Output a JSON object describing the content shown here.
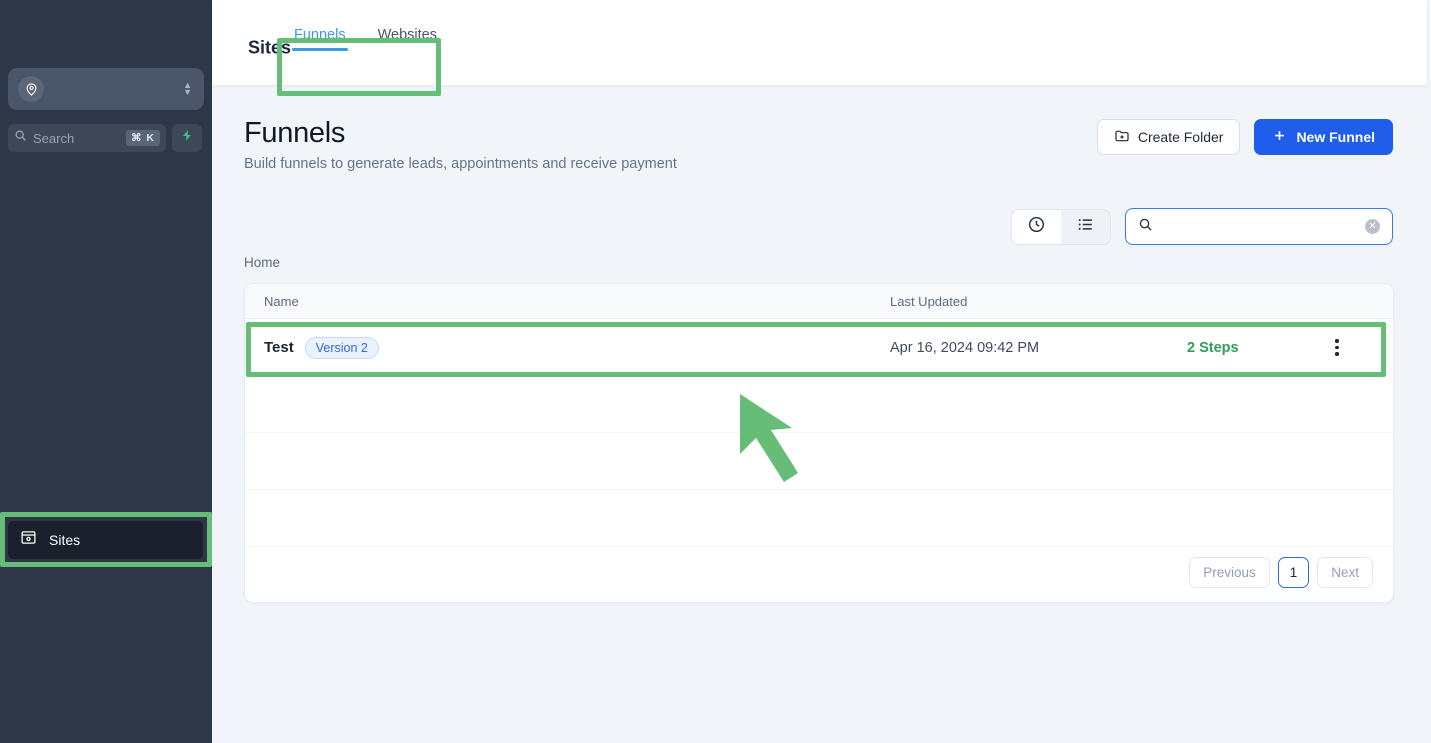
{
  "sidebar": {
    "location_switcher": {
      "icon": "location-pin-icon",
      "value": ""
    },
    "search": {
      "placeholder": "Search",
      "shortcut": "⌘ K",
      "icon": "search-icon"
    },
    "quick_action": {
      "icon": "lightning-bolt-icon"
    },
    "items": [
      {
        "label": "Sites",
        "icon": "sites-icon",
        "active": true
      }
    ]
  },
  "topbar": {
    "title": "Sites",
    "tabs": [
      {
        "label": "Funnels",
        "active": true
      },
      {
        "label": "Websites",
        "active": false
      }
    ]
  },
  "page": {
    "title": "Funnels",
    "subtitle": "Build funnels to generate leads, appointments and receive payment",
    "create_folder_label": "Create Folder",
    "new_funnel_label": "New Funnel",
    "breadcrumb": "Home"
  },
  "toolbar": {
    "view_recent_icon": "clock-icon",
    "view_list_icon": "list-icon",
    "search": {
      "value": "",
      "placeholder": "",
      "icon": "search-icon",
      "clear_icon": "clear-circle-icon"
    }
  },
  "table": {
    "columns": [
      "Name",
      "Last Updated",
      "",
      ""
    ],
    "rows": [
      {
        "name": "Test",
        "badge": "Version 2",
        "last_updated": "Apr 16, 2024 09:42 PM",
        "steps": "2 Steps",
        "menu_icon": "kebab-menu-icon"
      }
    ],
    "empty_row_count": 3
  },
  "pagination": {
    "previous_label": "Previous",
    "current_page": "1",
    "next_label": "Next"
  },
  "annotations": {
    "highlight_color": "#65bd77",
    "arrow_color": "#65bd77",
    "highlighted": [
      "sidebar-item-sites",
      "tabs-group",
      "funnel-row-test"
    ]
  },
  "colors": {
    "sidebar_bg": "#2d3748",
    "primary_blue": "#1f5eea",
    "tab_active": "#3b9ae1",
    "steps_green": "#2f9e5e",
    "badge_blue": "#2d6ae0"
  }
}
